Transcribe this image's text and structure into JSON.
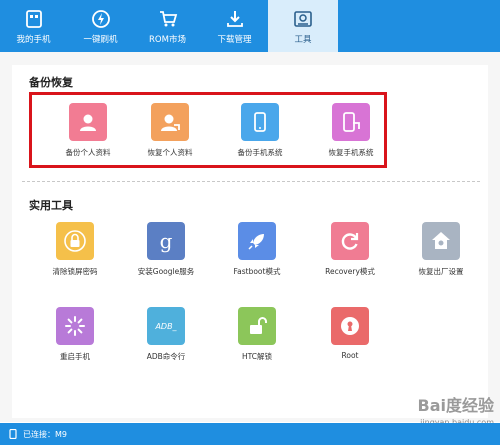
{
  "nav": {
    "tabs": [
      {
        "label": "我的手机",
        "icon": "phone-icon"
      },
      {
        "label": "一键刷机",
        "icon": "flash-icon"
      },
      {
        "label": "ROM市场",
        "icon": "cart-icon"
      },
      {
        "label": "下载管理",
        "icon": "download-icon"
      },
      {
        "label": "工具",
        "icon": "toolbox-icon",
        "active": true
      }
    ]
  },
  "backup": {
    "title": "备份恢复",
    "items": [
      {
        "label": "备份个人资料",
        "icon": "person-icon",
        "color": "#f27c93"
      },
      {
        "label": "恢复个人资料",
        "icon": "person-restore-icon",
        "color": "#f3a15d"
      },
      {
        "label": "备份手机系统",
        "icon": "phone-backup-icon",
        "color": "#4aa7eb"
      },
      {
        "label": "恢复手机系统",
        "icon": "phone-restore-icon",
        "color": "#d874d5"
      }
    ]
  },
  "utilities": {
    "title": "实用工具",
    "items": [
      {
        "label": "清除锁屏密码",
        "icon": "lock-icon",
        "color": "#f5c04a"
      },
      {
        "label": "安装Google服务",
        "icon": "google-icon",
        "color": "#5b7fc4"
      },
      {
        "label": "Fastboot模式",
        "icon": "rocket-icon",
        "color": "#5b8de6"
      },
      {
        "label": "Recovery模式",
        "icon": "refresh-icon",
        "color": "#f07c93"
      },
      {
        "label": "恢复出厂设置",
        "icon": "home-icon",
        "color": "#a9b4c2"
      },
      {
        "label": "重启手机",
        "icon": "loading-icon",
        "color": "#b87ad8"
      },
      {
        "label": "ADB命令行",
        "icon": "adb-icon",
        "color": "#4fb0dc"
      },
      {
        "label": "HTC解锁",
        "icon": "unlock-icon",
        "color": "#8cc65a"
      },
      {
        "label": "Root",
        "icon": "root-icon",
        "color": "#ea6a6a"
      }
    ]
  },
  "status": {
    "text": "已连接：M9"
  },
  "watermark": {
    "text": "Bai度经验",
    "url": "jingyan.baidu.com"
  }
}
